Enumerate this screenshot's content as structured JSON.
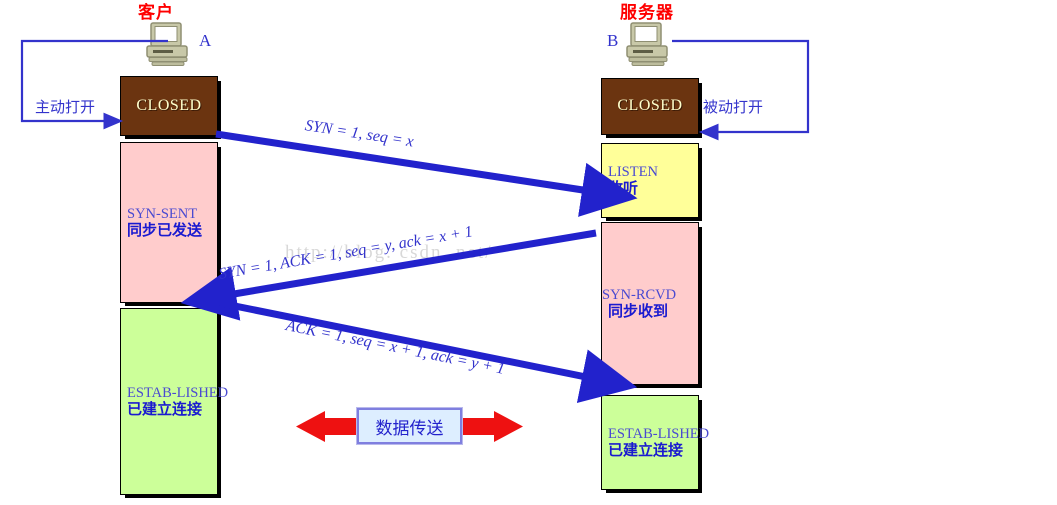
{
  "diagram": {
    "title_client": "客户",
    "title_server": "服务器",
    "node_a_label": "A",
    "node_b_label": "B",
    "watermark": "http://blog. csdn. net/"
  },
  "client": {
    "states": [
      {
        "en": "CLOSED",
        "cn": "",
        "color": "#6b3410"
      },
      {
        "en": "SYN-SENT",
        "cn": "同步已发送",
        "color": "#ffcccc"
      },
      {
        "en": "ESTAB-LISHED",
        "cn": "已建立连接",
        "color": "#ccff99"
      }
    ],
    "control_label": "主动打开"
  },
  "server": {
    "states": [
      {
        "en": "CLOSED",
        "cn": "",
        "color": "#6b3410"
      },
      {
        "en": "LISTEN",
        "cn": "收听",
        "color": "#ffff99"
      },
      {
        "en": "SYN-RCVD",
        "cn": "同步收到",
        "color": "#ffcccc"
      },
      {
        "en": "ESTAB-LISHED",
        "cn": "已建立连接",
        "color": "#ccff99"
      }
    ],
    "control_label": "被动打开"
  },
  "messages": [
    {
      "id": "seg1",
      "text": "SYN = 1, seq = x",
      "direction": "client-to-server"
    },
    {
      "id": "seg2",
      "text": "SYN = 1, ACK = 1, seq = y, ack = x + 1",
      "direction": "server-to-client"
    },
    {
      "id": "seg3",
      "text": "ACK = 1, seq = x + 1, ack = y + 1",
      "direction": "client-to-server"
    }
  ],
  "data_transfer": {
    "label": "数据传送"
  },
  "colors": {
    "arrow_blue": "#2222cc",
    "arrow_red": "#ee1111",
    "title_red": "#ff0000",
    "text_blue": "#3333cc"
  }
}
